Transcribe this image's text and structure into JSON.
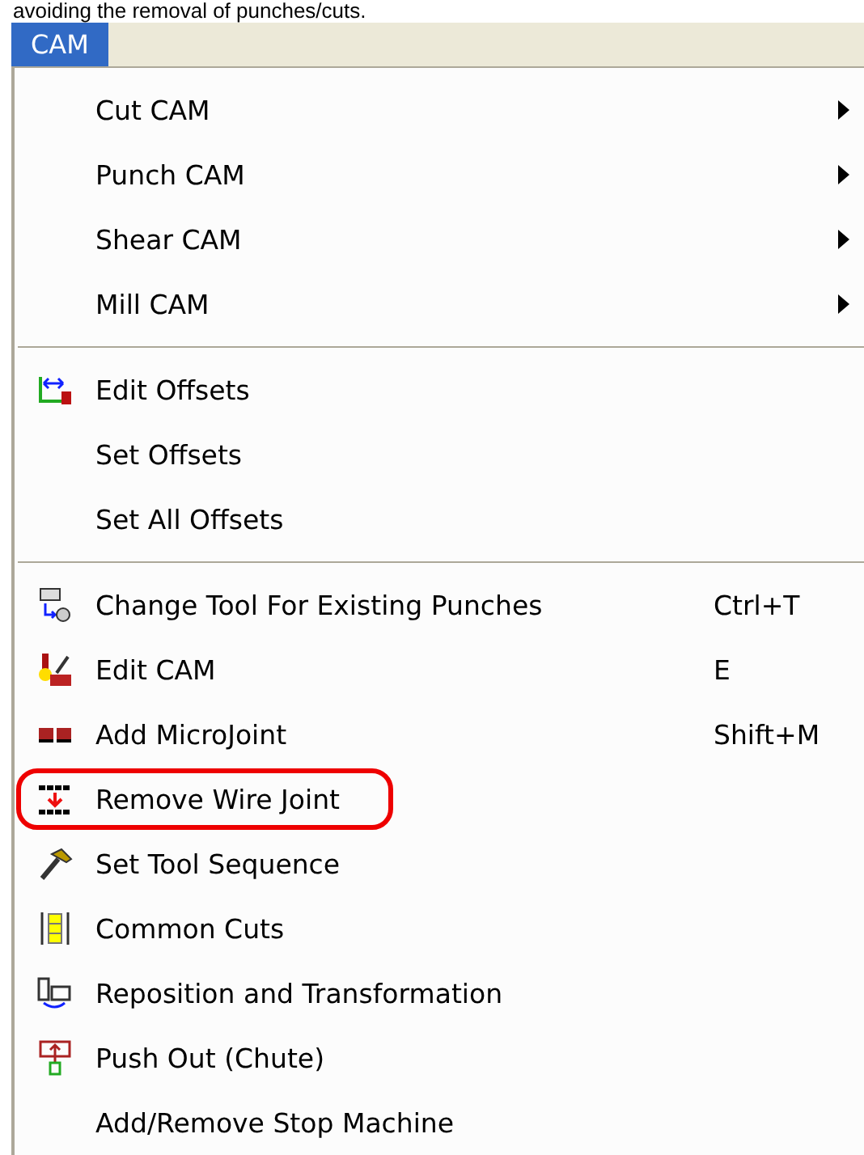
{
  "caption": "avoiding the removal of punches/cuts.",
  "menubar": [
    {
      "label": "CAM",
      "selected": true
    }
  ],
  "menu_groups": [
    {
      "items": [
        {
          "label": "Cut CAM",
          "icon": false,
          "submenu": true,
          "highlighted": false
        },
        {
          "label": "Punch CAM",
          "icon": false,
          "submenu": true,
          "highlighted": false
        },
        {
          "label": "Shear CAM",
          "icon": false,
          "submenu": true,
          "highlighted": false
        },
        {
          "label": "Mill CAM",
          "icon": false,
          "submenu": true,
          "highlighted": false
        }
      ]
    },
    {
      "items": [
        {
          "label": "Edit Offsets",
          "icon": true,
          "submenu": false,
          "highlighted": false
        },
        {
          "label": "Set Offsets",
          "icon": false,
          "submenu": false,
          "highlighted": false
        },
        {
          "label": "Set All Offsets",
          "icon": false,
          "submenu": false,
          "highlighted": false
        }
      ]
    },
    {
      "items": [
        {
          "label": "Change Tool For Existing Punches",
          "icon": true,
          "shortcut": "Ctrl+T",
          "submenu": false,
          "highlighted": false
        },
        {
          "label": "Edit CAM",
          "icon": true,
          "shortcut": "E",
          "submenu": false,
          "highlighted": false
        },
        {
          "label": "Add MicroJoint",
          "icon": true,
          "shortcut": "Shift+M",
          "submenu": false,
          "highlighted": false
        },
        {
          "label": "Remove Wire Joint",
          "icon": true,
          "submenu": false,
          "highlighted": true
        },
        {
          "label": "Set Tool Sequence",
          "icon": true,
          "submenu": false,
          "highlighted": false
        },
        {
          "label": "Common Cuts",
          "icon": true,
          "submenu": false,
          "highlighted": false
        },
        {
          "label": "Reposition and Transformation",
          "icon": true,
          "submenu": false,
          "highlighted": false
        },
        {
          "label": "Push Out (Chute)",
          "icon": true,
          "submenu": false,
          "highlighted": false
        },
        {
          "label": "Add/Remove Stop Machine",
          "icon": false,
          "submenu": false,
          "highlighted": false
        }
      ]
    }
  ]
}
